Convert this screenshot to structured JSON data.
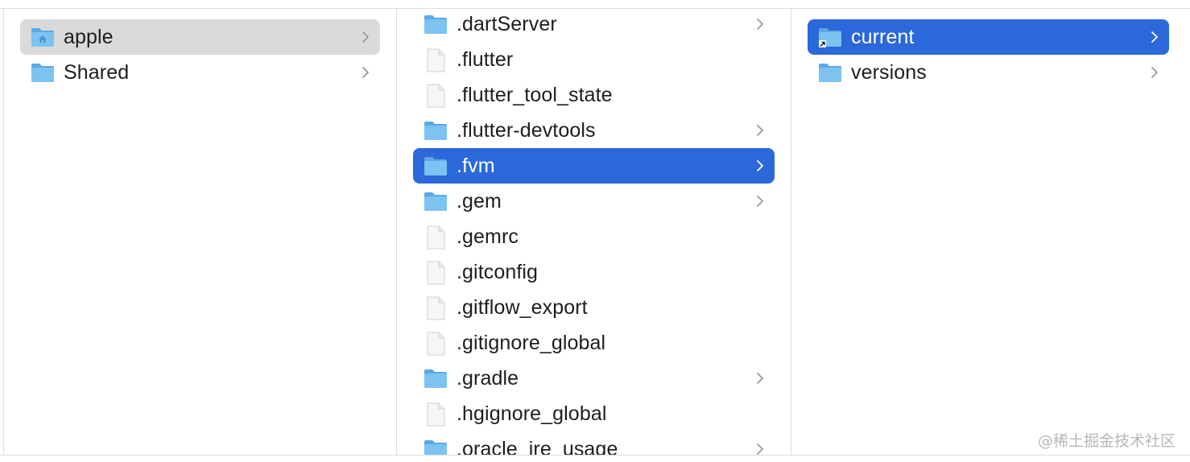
{
  "columns": [
    {
      "items": [
        {
          "label": "apple",
          "type": "home-folder",
          "has_children": true,
          "state": "selected-inactive"
        },
        {
          "label": "Shared",
          "type": "folder",
          "has_children": true,
          "state": "normal"
        }
      ]
    },
    {
      "items": [
        {
          "label": ".dartServer",
          "type": "folder",
          "has_children": true,
          "state": "normal"
        },
        {
          "label": ".flutter",
          "type": "file",
          "has_children": false,
          "state": "normal"
        },
        {
          "label": ".flutter_tool_state",
          "type": "file",
          "has_children": false,
          "state": "normal"
        },
        {
          "label": ".flutter-devtools",
          "type": "folder",
          "has_children": true,
          "state": "normal"
        },
        {
          "label": ".fvm",
          "type": "folder",
          "has_children": true,
          "state": "selected-active"
        },
        {
          "label": ".gem",
          "type": "folder",
          "has_children": true,
          "state": "normal"
        },
        {
          "label": ".gemrc",
          "type": "file",
          "has_children": false,
          "state": "normal"
        },
        {
          "label": ".gitconfig",
          "type": "file",
          "has_children": false,
          "state": "normal"
        },
        {
          "label": ".gitflow_export",
          "type": "file",
          "has_children": false,
          "state": "normal"
        },
        {
          "label": ".gitignore_global",
          "type": "file",
          "has_children": false,
          "state": "normal"
        },
        {
          "label": ".gradle",
          "type": "folder",
          "has_children": true,
          "state": "normal"
        },
        {
          "label": ".hgignore_global",
          "type": "file",
          "has_children": false,
          "state": "normal"
        },
        {
          "label": ".oracle_jre_usage",
          "type": "folder",
          "has_children": true,
          "state": "normal"
        }
      ]
    },
    {
      "items": [
        {
          "label": "current",
          "type": "alias-folder",
          "has_children": true,
          "state": "selected-active"
        },
        {
          "label": "versions",
          "type": "folder",
          "has_children": true,
          "state": "normal"
        }
      ]
    }
  ],
  "watermark": "@稀土掘金技术社区",
  "colors": {
    "selection_active": "#2b68d9",
    "selection_inactive": "#dadada",
    "folder_body": "#7cc3f2",
    "folder_tab": "#5aa9e4",
    "file_page": "#f6f6f6",
    "chevron": "#9a9a9a"
  }
}
